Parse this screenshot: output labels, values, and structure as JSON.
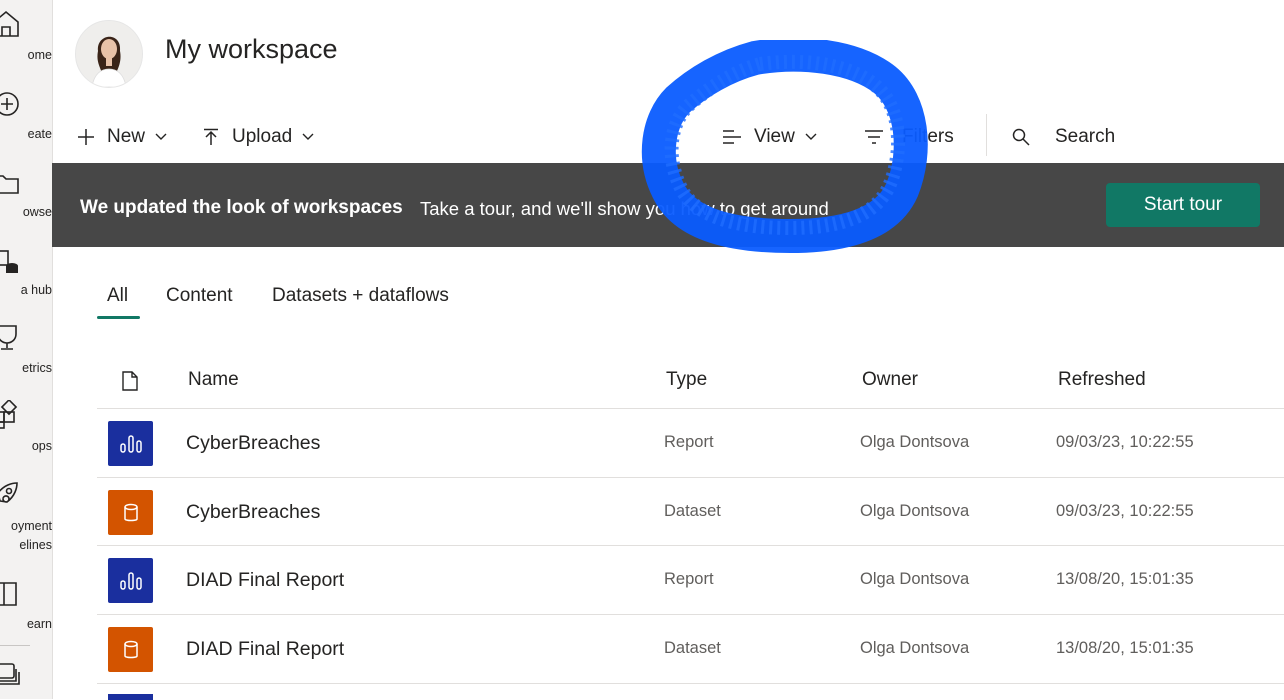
{
  "colors": {
    "accent": "#117865",
    "banner_bg": "#474747",
    "report_icon_bg": "#1a2f9e",
    "dataset_icon_bg": "#d35400",
    "scribble": "#0a5cff"
  },
  "leftnav": {
    "items": [
      {
        "label": "ome",
        "icon": "home-icon"
      },
      {
        "label": "eate",
        "icon": "create-plus-icon"
      },
      {
        "label": "owse",
        "icon": "folder-icon"
      },
      {
        "label": "a hub",
        "icon": "data-hub-icon"
      },
      {
        "label": "etrics",
        "icon": "trophy-icon"
      },
      {
        "label": "ops",
        "icon": "apps-icon"
      },
      {
        "label": "oyment",
        "label2": "elines",
        "icon": "rocket-icon"
      },
      {
        "label": "earn",
        "icon": "book-icon"
      },
      {
        "label": "",
        "icon": "workspaces-icon"
      }
    ]
  },
  "header": {
    "title": "My workspace"
  },
  "toolbar": {
    "new_label": "New",
    "upload_label": "Upload",
    "view_label": "View",
    "filters_label": "Filters",
    "search_label": "Search"
  },
  "banner": {
    "title": "We updated the look of workspaces",
    "text": "Take a tour, and we'll show you how to get around",
    "button": "Start tour"
  },
  "tabs": [
    {
      "label": "All",
      "selected": true
    },
    {
      "label": "Content",
      "selected": false
    },
    {
      "label": "Datasets + dataflows",
      "selected": false
    }
  ],
  "table": {
    "headers": {
      "name": "Name",
      "type": "Type",
      "owner": "Owner",
      "refreshed": "Refreshed"
    },
    "rows": [
      {
        "name": "CyberBreaches",
        "type": "Report",
        "owner": "Olga Dontsova",
        "refreshed": "09/03/23, 10:22:55",
        "icon": "report-icon"
      },
      {
        "name": "CyberBreaches",
        "type": "Dataset",
        "owner": "Olga Dontsova",
        "refreshed": "09/03/23, 10:22:55",
        "icon": "dataset-icon"
      },
      {
        "name": "DIAD Final Report",
        "type": "Report",
        "owner": "Olga Dontsova",
        "refreshed": "13/08/20, 15:01:35",
        "icon": "report-icon"
      },
      {
        "name": "DIAD Final Report",
        "type": "Dataset",
        "owner": "Olga Dontsova",
        "refreshed": "13/08/20, 15:01:35",
        "icon": "dataset-icon"
      }
    ]
  }
}
